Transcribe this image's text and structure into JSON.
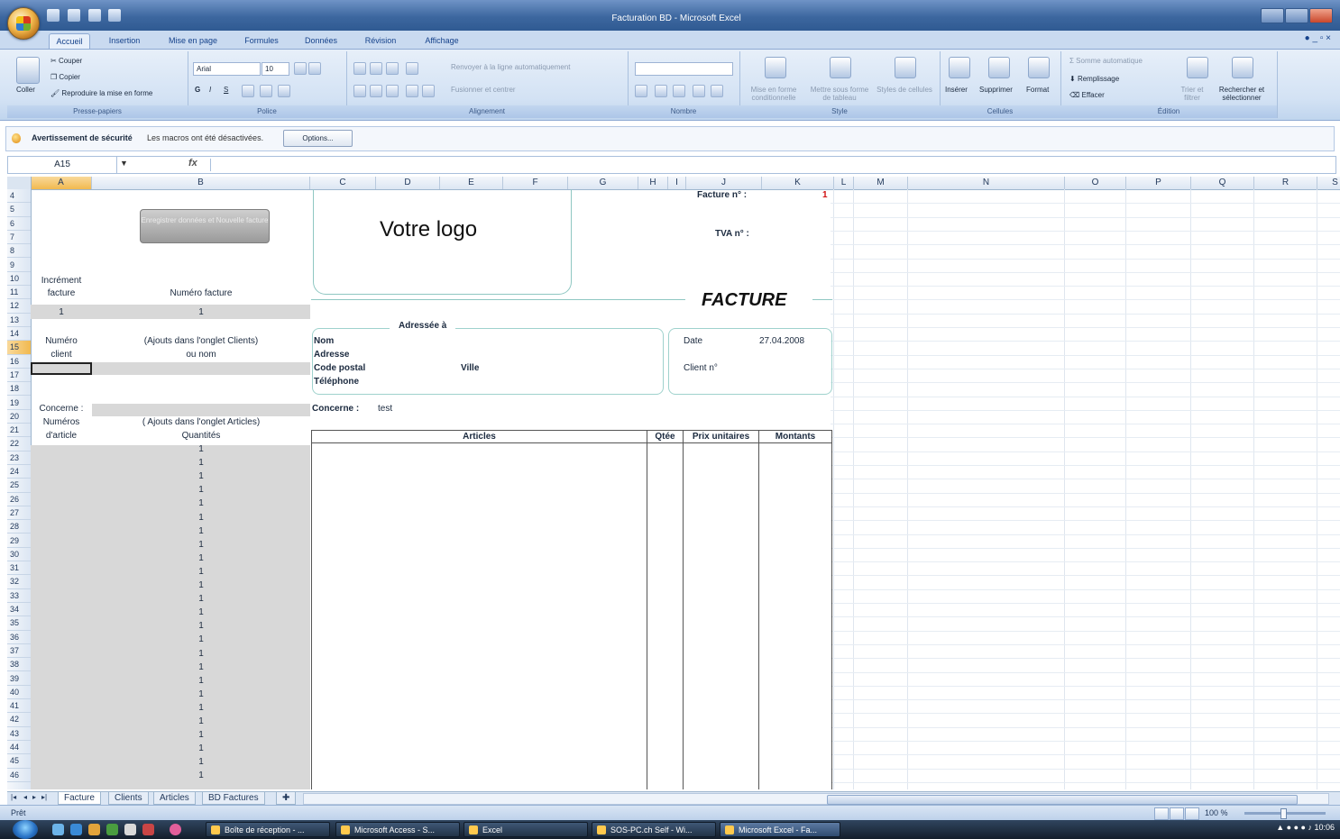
{
  "window": {
    "title": "Facturation BD - Microsoft Excel"
  },
  "tabs": [
    "Accueil",
    "Insertion",
    "Mise en page",
    "Formules",
    "Données",
    "Révision",
    "Affichage"
  ],
  "ribbon": {
    "clipboard": {
      "label": "Presse-papiers",
      "paste": "Coller",
      "cut": "Couper",
      "copy": "Copier",
      "format_painter": "Reproduire la mise en forme"
    },
    "font": {
      "label": "Police",
      "name": "Arial",
      "size": "10"
    },
    "alignment": {
      "label": "Alignement",
      "wrap": "Renvoyer à la ligne automatiquement",
      "merge": "Fusionner et centrer"
    },
    "number": {
      "label": "Nombre"
    },
    "style": {
      "label": "Style",
      "cond": "Mise en forme conditionnelle",
      "table": "Mettre sous forme de tableau",
      "cell_styles": "Styles de cellules"
    },
    "cells": {
      "label": "Cellules",
      "insert": "Insérer",
      "delete": "Supprimer",
      "format": "Format"
    },
    "editing": {
      "label": "Édition",
      "autosum": "Somme automatique",
      "fill": "Remplissage",
      "clear": "Effacer",
      "sort": "Trier et filtrer",
      "find": "Rechercher et sélectionner"
    }
  },
  "security": {
    "title": "Avertissement de sécurité",
    "text": "Les macros ont été désactivées.",
    "options": "Options..."
  },
  "formula": {
    "namebox": "A15",
    "fx": "fx",
    "value": ""
  },
  "columns": [
    "A",
    "B",
    "C",
    "D",
    "E",
    "F",
    "G",
    "H",
    "I",
    "J",
    "K",
    "L",
    "M",
    "N",
    "O",
    "P",
    "Q",
    "R",
    "S"
  ],
  "rows": [
    "4",
    "5",
    "6",
    "7",
    "8",
    "9",
    "10",
    "11",
    "12",
    "13",
    "14",
    "15",
    "16",
    "17",
    "18",
    "19",
    "20",
    "21",
    "22",
    "23",
    "24",
    "25",
    "26",
    "27",
    "28",
    "29",
    "30",
    "31",
    "32",
    "33",
    "34",
    "35",
    "36",
    "37",
    "38",
    "39",
    "40",
    "41",
    "42",
    "43",
    "44",
    "45",
    "46"
  ],
  "sheet": {
    "button_register": "Enregistrer données et Nouvelle facture",
    "increment_1": "Incrément",
    "increment_2": "facture",
    "invoice_number_label": "Numéro facture",
    "increment_value": "1",
    "invoice_number_value": "1",
    "client_num_1": "Numéro",
    "client_num_2": "client",
    "clients_hint_1": "(Ajouts dans l'onglet Clients)",
    "clients_hint_2": "ou nom",
    "concerne_left": "Concerne :",
    "article_num_1": "Numéros",
    "article_num_2": "d'article",
    "articles_hint": "( Ajouts dans l'onglet Articles)",
    "quantities": "Quantités",
    "qty_values": [
      "1",
      "1",
      "1",
      "1",
      "1",
      "1",
      "1",
      "1",
      "1",
      "1",
      "1",
      "1",
      "1",
      "1",
      "1",
      "1",
      "1",
      "1",
      "1",
      "1",
      "1",
      "1",
      "1",
      "1",
      "1"
    ],
    "logo": "Votre logo",
    "invoice_no_label": "Facture n° :",
    "invoice_no_value": "1",
    "tva_label": "TVA n° :",
    "facture_title": "FACTURE",
    "addressee": "Adressée à",
    "nom": "Nom",
    "adresse": "Adresse",
    "code_postal": "Code postal",
    "ville": "Ville",
    "telephone": "Téléphone",
    "date_label": "Date",
    "date_value": "27.04.2008",
    "client_no_label": "Client n°",
    "concerne_label": "Concerne :",
    "concerne_value": "test",
    "table_headers": [
      "Articles",
      "Qtée",
      "Prix unitaires",
      "Montants"
    ]
  },
  "sheet_tabs": [
    "Facture",
    "Clients",
    "Articles",
    "BD Factures"
  ],
  "status": {
    "ready": "Prêt",
    "zoom": "100 %"
  },
  "taskbar": {
    "items": [
      "Boîte de réception - ...",
      "Microsoft Access - S...",
      "Excel",
      "SOS-PC.ch Self - Wi...",
      "Microsoft Excel - Fa..."
    ],
    "clock": "10:06"
  }
}
